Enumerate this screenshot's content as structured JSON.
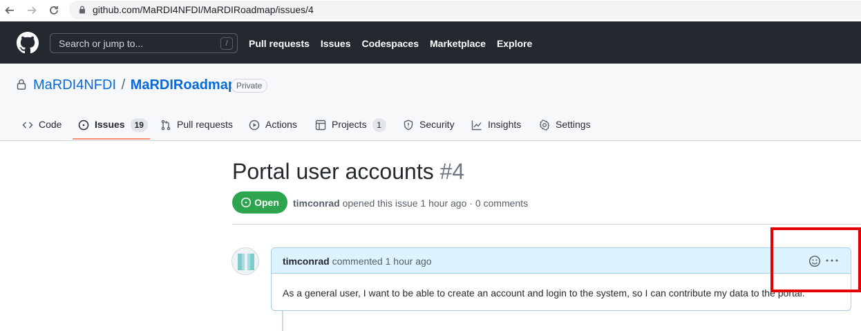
{
  "browser": {
    "url": "github.com/MaRDI4NFDI/MaRDIRoadmap/issues/4"
  },
  "header": {
    "search_placeholder": "Search or jump to...",
    "search_shortcut": "/",
    "nav_links": [
      "Pull requests",
      "Issues",
      "Codespaces",
      "Marketplace",
      "Explore"
    ]
  },
  "repo": {
    "owner": "MaRDI4NFDI",
    "separator": "/",
    "name": "MaRDIRoadmap",
    "visibility": "Private",
    "tabs": [
      {
        "label": "Code",
        "icon": "code-icon"
      },
      {
        "label": "Issues",
        "icon": "issue-opened-icon",
        "count": "19",
        "active": true
      },
      {
        "label": "Pull requests",
        "icon": "git-pull-request-icon"
      },
      {
        "label": "Actions",
        "icon": "play-icon"
      },
      {
        "label": "Projects",
        "icon": "table-icon",
        "count": "1"
      },
      {
        "label": "Security",
        "icon": "shield-icon"
      },
      {
        "label": "Insights",
        "icon": "graph-icon"
      },
      {
        "label": "Settings",
        "icon": "gear-icon"
      }
    ]
  },
  "issue": {
    "title": "Portal user accounts",
    "number": "#4",
    "state": "Open",
    "state_color": "#2da44e",
    "author": "timconrad",
    "meta_text": " opened this issue 1 hour ago · 0 comments"
  },
  "comment": {
    "author": "timconrad",
    "action_text": " commented 1 hour ago",
    "body": "As a general user, I want to be able to create an account and login to the system, so I can contribute my data to the portal."
  },
  "highlight_color": "#e60000"
}
